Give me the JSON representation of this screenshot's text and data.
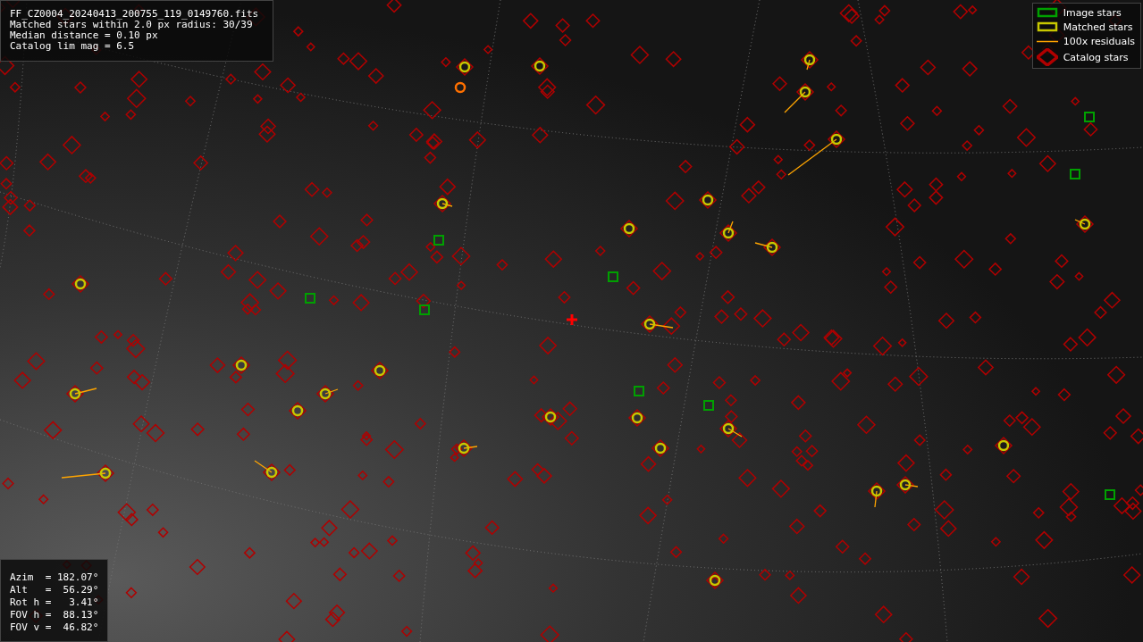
{
  "info_lines": [
    "FF_CZ0004_20240413_200755_119_0149760.fits",
    "Matched stars within 2.0 px radius: 30/39",
    "Median distance = 0.10 px",
    "Catalog lim mag = 6.5"
  ],
  "legend": [
    {
      "kind": "image",
      "label": "Image stars",
      "color": "#00a000"
    },
    {
      "kind": "matched",
      "label": "Matched stars",
      "color": "#c8c800"
    },
    {
      "kind": "residual",
      "label": "100x residuals",
      "color": "#ffa500"
    },
    {
      "kind": "catalog",
      "label": "Catalog stars",
      "color": "#b00000"
    }
  ],
  "pointing_lines": [
    "Azim  = 182.07°",
    "Alt   =  56.29°",
    "Rot h =   3.41°",
    "FOV h =  88.13°",
    "FOV v =  46.82°"
  ]
}
